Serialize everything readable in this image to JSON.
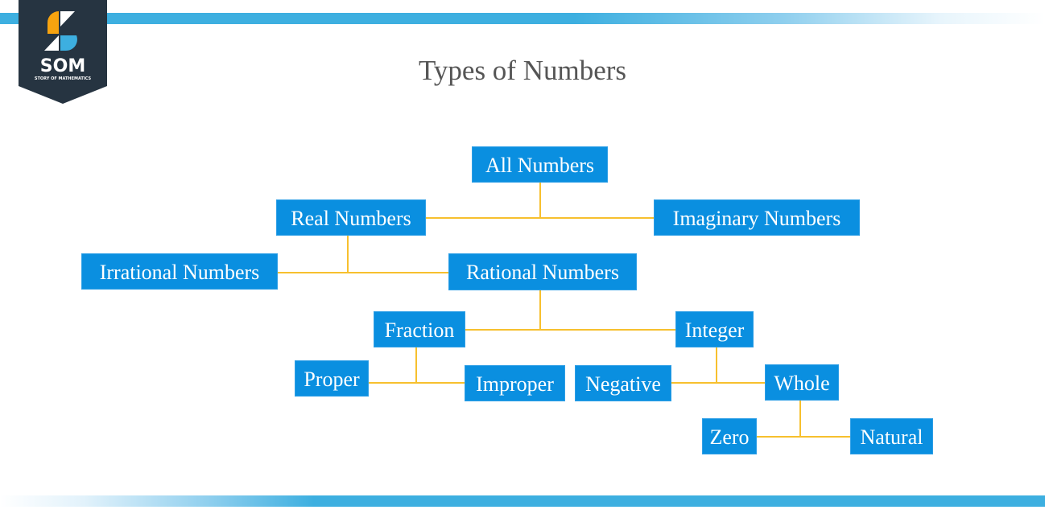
{
  "header": {
    "logo_text": "SOM",
    "logo_subtext": "STORY OF MATHEMATICS",
    "title": "Types of Numbers"
  },
  "colors": {
    "node_fill": "#0a8fe0",
    "node_text": "#ffffff",
    "connector": "#f7c02e",
    "accent_bar": "#3dafe0",
    "logo_bg": "#263441",
    "logo_orange": "#f7a30f",
    "logo_blue": "#3dafe0"
  },
  "diagram": {
    "type": "tree",
    "nodes": [
      {
        "id": "all",
        "label": "All Numbers"
      },
      {
        "id": "real",
        "label": "Real Numbers"
      },
      {
        "id": "imaginary",
        "label": "Imaginary Numbers"
      },
      {
        "id": "irrational",
        "label": "Irrational Numbers"
      },
      {
        "id": "rational",
        "label": "Rational Numbers"
      },
      {
        "id": "fraction",
        "label": "Fraction"
      },
      {
        "id": "integer",
        "label": "Integer"
      },
      {
        "id": "proper",
        "label": "Proper"
      },
      {
        "id": "improper",
        "label": "Improper"
      },
      {
        "id": "negative",
        "label": "Negative"
      },
      {
        "id": "whole",
        "label": "Whole"
      },
      {
        "id": "zero",
        "label": "Zero"
      },
      {
        "id": "natural",
        "label": "Natural"
      }
    ],
    "edges": [
      {
        "parent": "all",
        "children": [
          "real",
          "imaginary"
        ]
      },
      {
        "parent": "real",
        "children": [
          "irrational",
          "rational"
        ]
      },
      {
        "parent": "rational",
        "children": [
          "fraction",
          "integer"
        ]
      },
      {
        "parent": "fraction",
        "children": [
          "proper",
          "improper"
        ]
      },
      {
        "parent": "integer",
        "children": [
          "negative",
          "whole"
        ]
      },
      {
        "parent": "whole",
        "children": [
          "zero",
          "natural"
        ]
      }
    ]
  }
}
